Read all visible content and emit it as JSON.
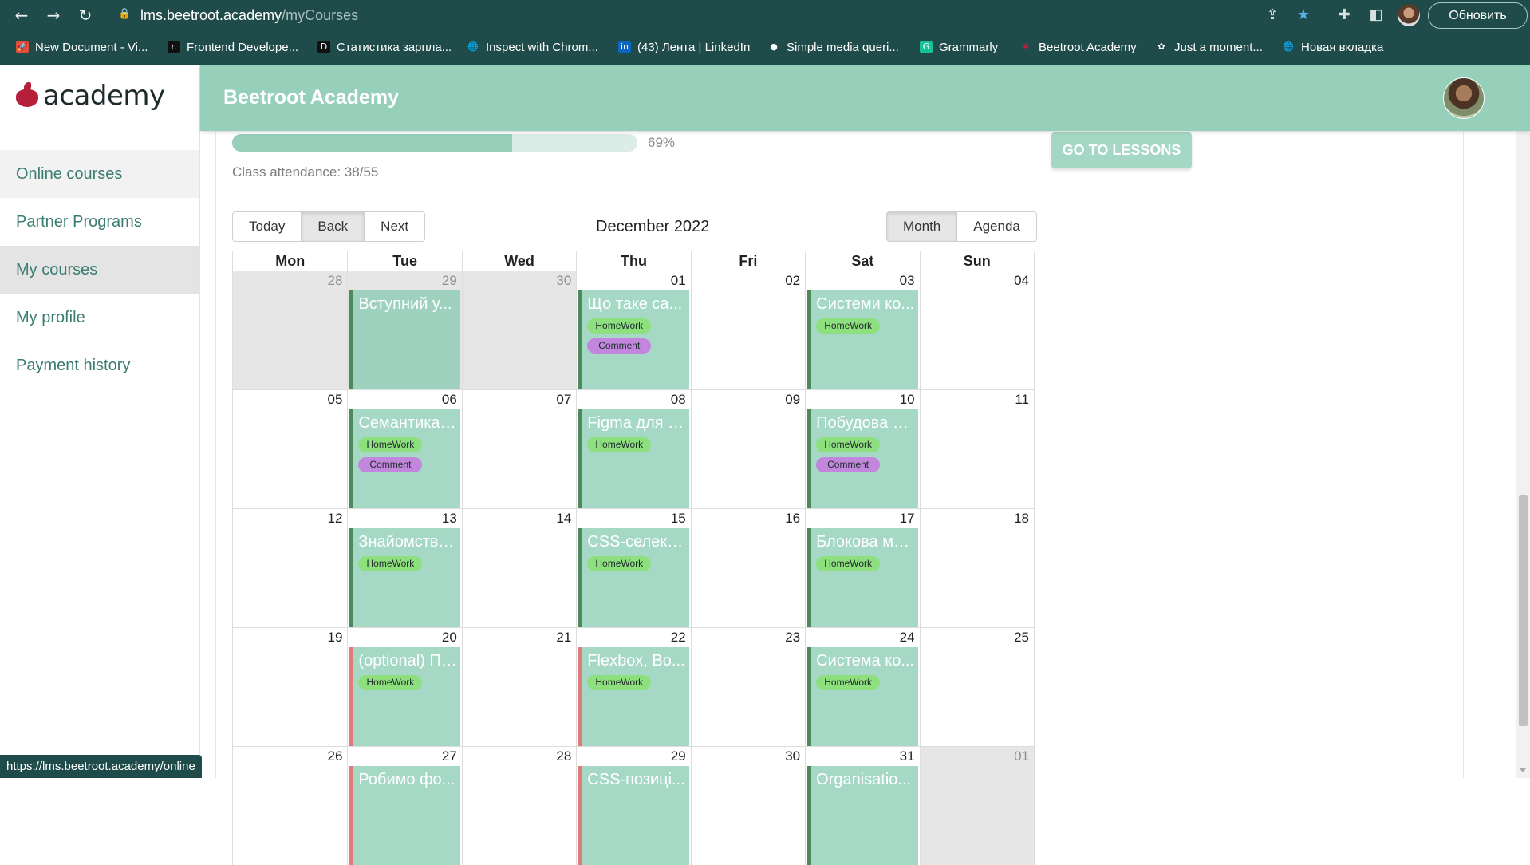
{
  "browser": {
    "url_host": "lms.beetroot.academy",
    "url_path": "/myCourses",
    "update_label": "Обновить",
    "bookmarks": [
      {
        "label": "New Document - Vi...",
        "icon": "rocket-icon"
      },
      {
        "label": "Frontend Develope...",
        "icon": "r-logo-icon"
      },
      {
        "label": "Статистика зарпла...",
        "icon": "dou-icon"
      },
      {
        "label": "Inspect with Chrom...",
        "icon": "globe-icon"
      },
      {
        "label": "(43) Лента | LinkedIn",
        "icon": "linkedin-icon"
      },
      {
        "label": "Simple media queri...",
        "icon": "github-icon"
      },
      {
        "label": "Grammarly",
        "icon": "grammarly-icon"
      },
      {
        "label": "Beetroot Academy",
        "icon": "beet-icon"
      },
      {
        "label": "Just a moment...",
        "icon": "openai-icon"
      },
      {
        "label": "Новая вкладка",
        "icon": "globe-icon"
      }
    ],
    "status_url": "https://lms.beetroot.academy/online"
  },
  "app": {
    "logo_text": "academy",
    "header_title": "Beetroot Academy",
    "sidebar": [
      {
        "label": "Online courses"
      },
      {
        "label": "Partner Programs"
      },
      {
        "label": "My courses"
      },
      {
        "label": "My profile"
      },
      {
        "label": "Payment history"
      }
    ],
    "progress_percent": 69,
    "progress_label": "69%",
    "attendance": "Class attendance: 38/55",
    "go_to_lessons": "GO TO LESSONS",
    "colors": {
      "accent": "#96cfba",
      "brand": "#b51f3a",
      "homework": "#8ee07e",
      "comment": "#c287dd"
    }
  },
  "calendar": {
    "nav": {
      "today": "Today",
      "back": "Back",
      "next": "Next"
    },
    "month_label": "December 2022",
    "views": {
      "month": "Month",
      "agenda": "Agenda"
    },
    "weekdays": [
      "Mon",
      "Tue",
      "Wed",
      "Thu",
      "Fri",
      "Sat",
      "Sun"
    ],
    "homework_label": "HomeWork",
    "comment_label": "Comment",
    "weeks": [
      [
        {
          "day": "28",
          "off": true
        },
        {
          "day": "29",
          "off": true,
          "event": {
            "title": "Вступний у...",
            "homework": false,
            "comment": false
          }
        },
        {
          "day": "30",
          "off": true
        },
        {
          "day": "01",
          "event": {
            "title": "Що таке са...",
            "homework": true,
            "comment": true
          }
        },
        {
          "day": "02"
        },
        {
          "day": "03",
          "event": {
            "title": "Системи ко...",
            "homework": true,
            "comment": false
          }
        },
        {
          "day": "04"
        }
      ],
      [
        {
          "day": "05"
        },
        {
          "day": "06",
          "event": {
            "title": "Семантика, ...",
            "homework": true,
            "comment": true
          }
        },
        {
          "day": "07"
        },
        {
          "day": "08",
          "event": {
            "title": "Figma для F...",
            "homework": true,
            "comment": false
          }
        },
        {
          "day": "09"
        },
        {
          "day": "10",
          "event": {
            "title": "Побудова ф...",
            "homework": true,
            "comment": true
          }
        },
        {
          "day": "11"
        }
      ],
      [
        {
          "day": "12"
        },
        {
          "day": "13",
          "event": {
            "title": "Знайомство...",
            "homework": true,
            "comment": false
          }
        },
        {
          "day": "14"
        },
        {
          "day": "15",
          "event": {
            "title": "CSS-селект...",
            "homework": true,
            "comment": false
          }
        },
        {
          "day": "16"
        },
        {
          "day": "17",
          "event": {
            "title": "Блокова мо...",
            "homework": true,
            "comment": false
          }
        },
        {
          "day": "18"
        }
      ],
      [
        {
          "day": "19"
        },
        {
          "day": "20",
          "event": {
            "title": "(optional) Пі...",
            "homework": true,
            "comment": false,
            "alt": true
          }
        },
        {
          "day": "21"
        },
        {
          "day": "22",
          "event": {
            "title": "Flexbox, Bo...",
            "homework": true,
            "comment": false,
            "alt": true
          }
        },
        {
          "day": "23"
        },
        {
          "day": "24",
          "event": {
            "title": "Система ко...",
            "homework": true,
            "comment": false
          }
        },
        {
          "day": "25"
        }
      ],
      [
        {
          "day": "26"
        },
        {
          "day": "27",
          "event": {
            "title": "Робимо фо...",
            "homework": false,
            "comment": false,
            "alt": true
          }
        },
        {
          "day": "28"
        },
        {
          "day": "29",
          "event": {
            "title": "CSS-позиці...",
            "homework": false,
            "comment": false,
            "alt": true
          }
        },
        {
          "day": "30"
        },
        {
          "day": "31",
          "event": {
            "title": "Organisatio...",
            "homework": false,
            "comment": false
          }
        },
        {
          "day": "01",
          "off": true
        }
      ]
    ]
  }
}
